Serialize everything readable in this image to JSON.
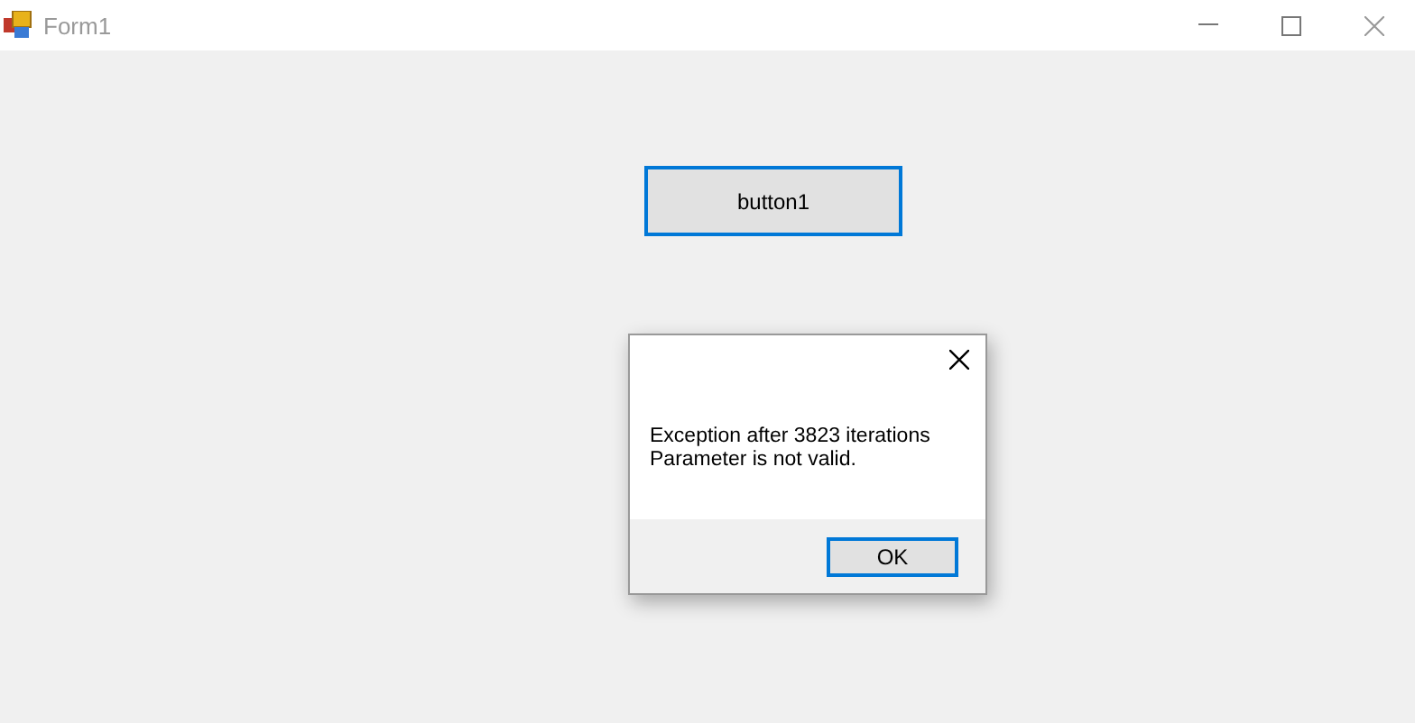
{
  "window": {
    "title": "Form1"
  },
  "form_button": {
    "label": "button1",
    "focused": true
  },
  "dialog": {
    "message_lines": [
      "Exception after 3823 iterations",
      "Parameter is not valid."
    ],
    "button": "OK"
  }
}
